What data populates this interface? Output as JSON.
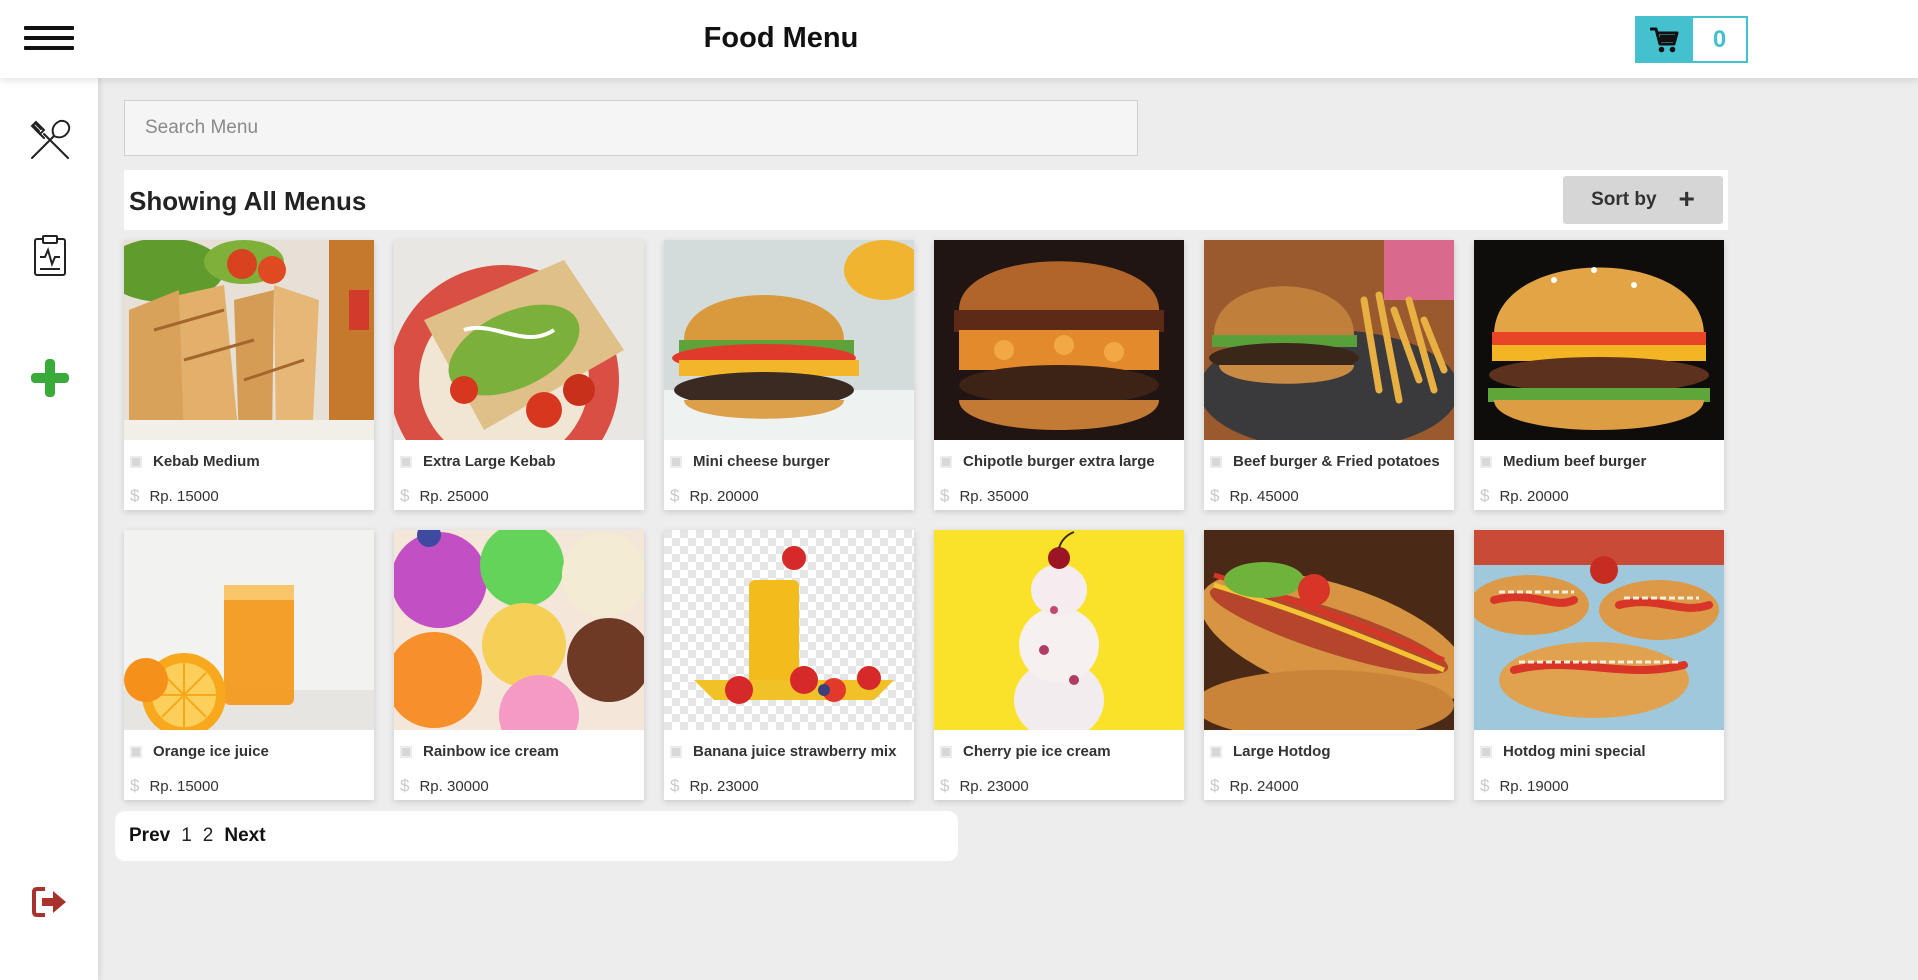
{
  "header": {
    "title": "Food Menu",
    "cart_count": "0"
  },
  "search": {
    "placeholder": "Search Menu"
  },
  "section": {
    "title": "Showing All Menus",
    "sort_label": "Sort by"
  },
  "menu_items": [
    {
      "name": "Kebab Medium",
      "price": "Rp. 15000"
    },
    {
      "name": "Extra Large Kebab",
      "price": "Rp. 25000"
    },
    {
      "name": "Mini cheese burger",
      "price": "Rp. 20000"
    },
    {
      "name": "Chipotle burger extra large",
      "price": "Rp. 35000"
    },
    {
      "name": "Beef burger & Fried potatoes",
      "price": "Rp. 45000"
    },
    {
      "name": "Medium beef burger",
      "price": "Rp. 20000"
    },
    {
      "name": "Orange ice juice",
      "price": "Rp. 15000"
    },
    {
      "name": "Rainbow ice cream",
      "price": "Rp. 30000"
    },
    {
      "name": "Banana juice strawberry mix",
      "price": "Rp. 23000"
    },
    {
      "name": "Cherry pie ice cream",
      "price": "Rp. 23000"
    },
    {
      "name": "Large Hotdog",
      "price": "Rp. 24000"
    },
    {
      "name": "Hotdog mini special",
      "price": "Rp. 19000"
    }
  ],
  "pagination": {
    "prev": "Prev",
    "pages": [
      "1",
      "2"
    ],
    "next": "Next"
  },
  "colors": {
    "accent": "#45c0cf",
    "add": "#3aaa3a",
    "logout": "#a8322d",
    "background": "#ededed"
  },
  "icons": {
    "sidebar": [
      "fork-knife-icon",
      "clipboard-icon",
      "add-icon",
      "logout-icon"
    ],
    "cart": "cart-icon"
  }
}
